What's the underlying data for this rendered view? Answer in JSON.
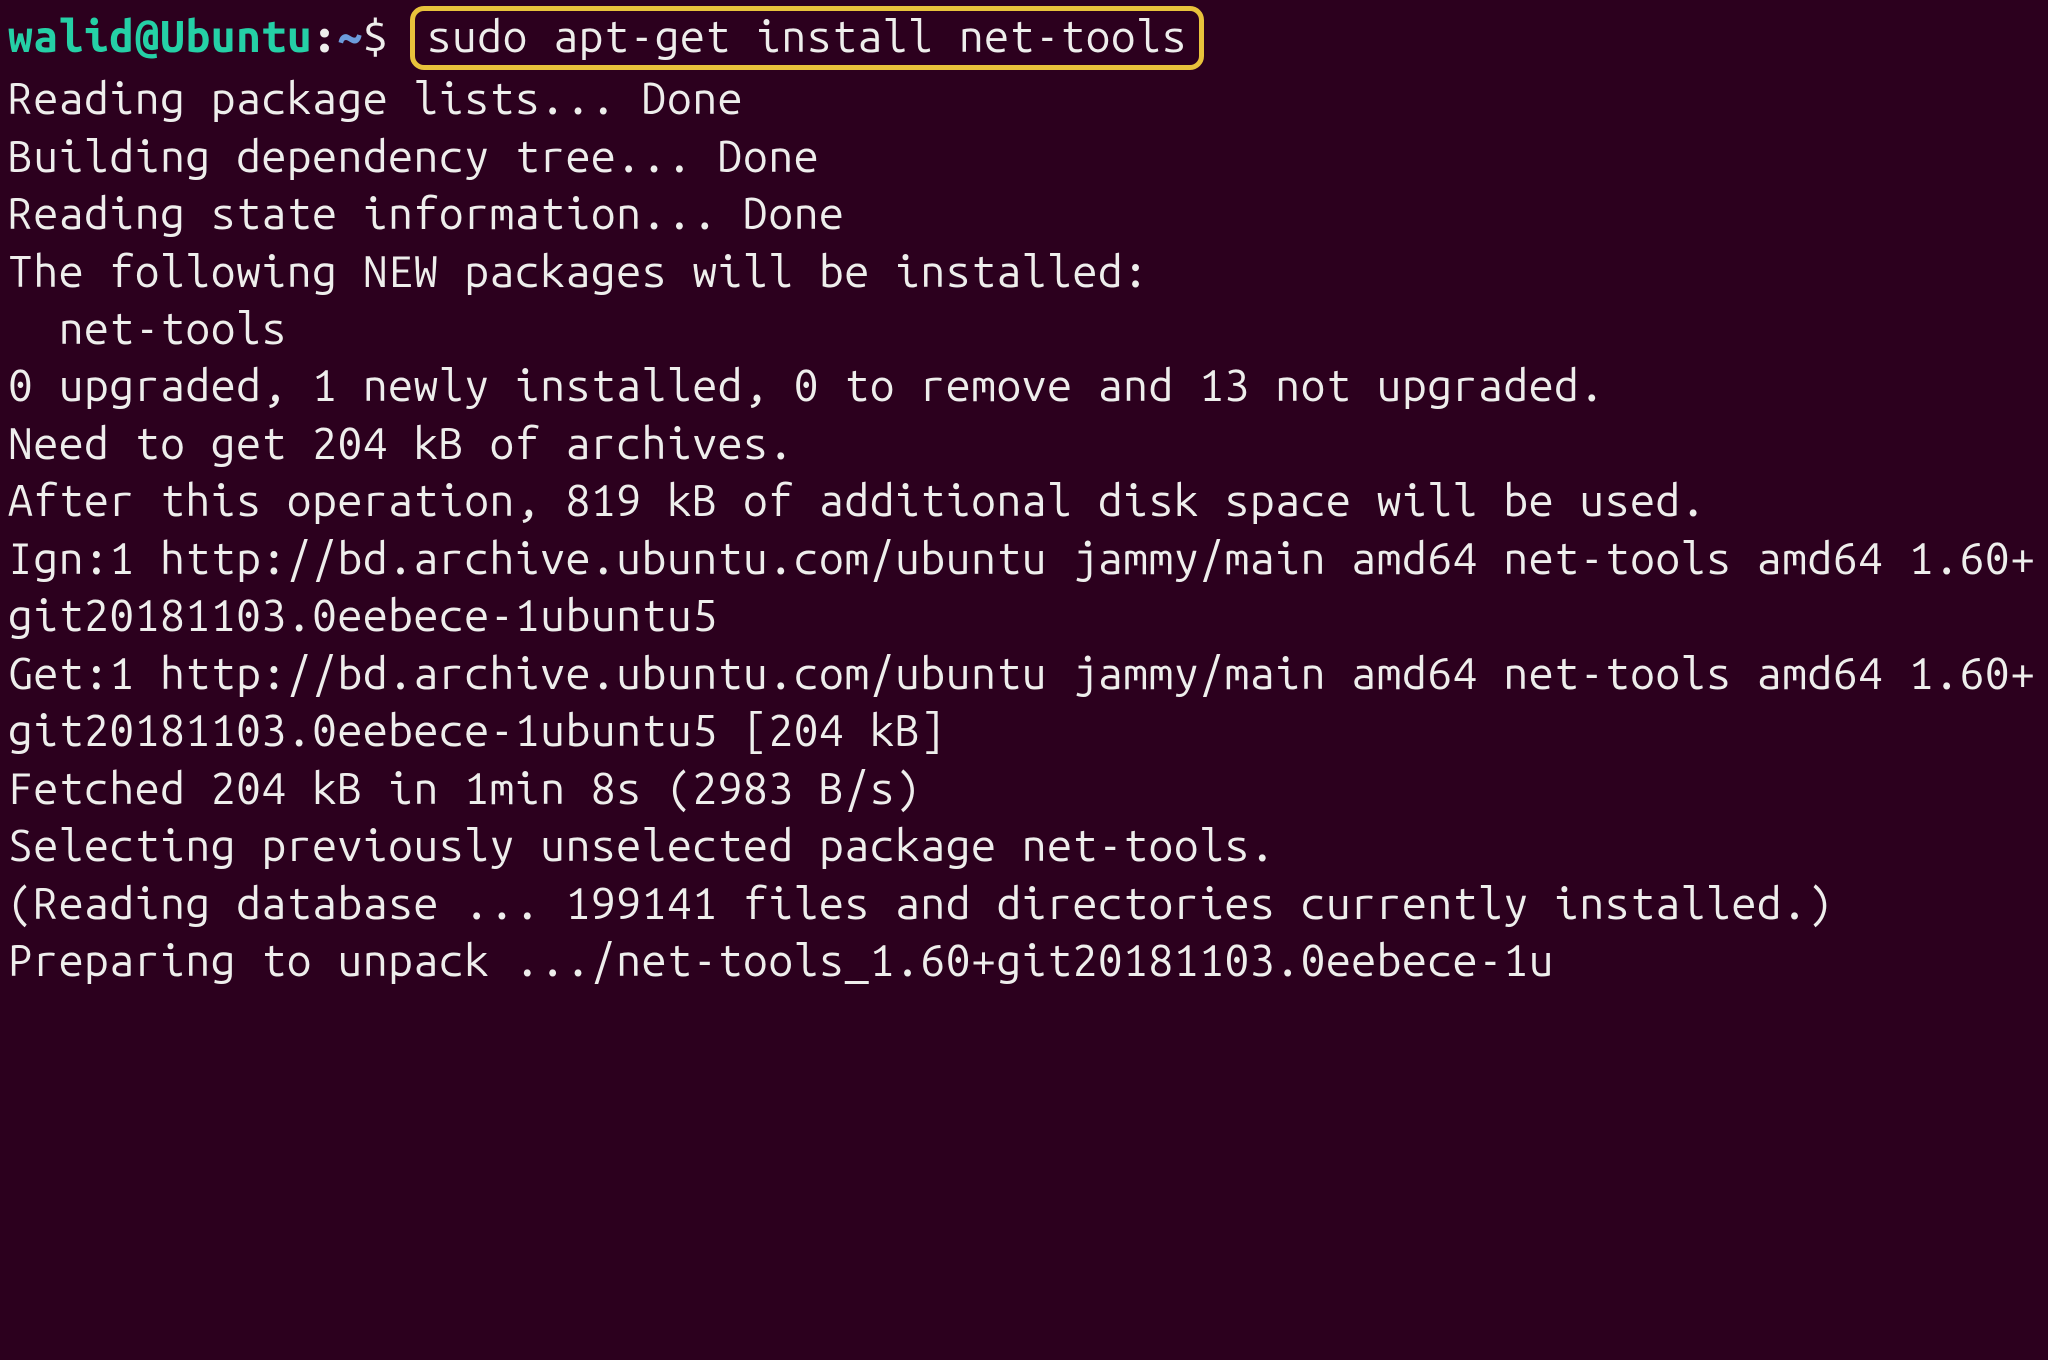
{
  "prompt": {
    "user": "walid",
    "at": "@",
    "host": "Ubuntu",
    "colon": ":",
    "path": "~",
    "dollar": "$ ",
    "command": "sudo apt-get install net-tools"
  },
  "output": "Reading package lists... Done\nBuilding dependency tree... Done\nReading state information... Done\nThe following NEW packages will be installed:\n  net-tools\n0 upgraded, 1 newly installed, 0 to remove and 13 not upgraded.\nNeed to get 204 kB of archives.\nAfter this operation, 819 kB of additional disk space will be used.\nIgn:1 http://bd.archive.ubuntu.com/ubuntu jammy/main amd64 net-tools amd64 1.60+git20181103.0eebece-1ubuntu5\nGet:1 http://bd.archive.ubuntu.com/ubuntu jammy/main amd64 net-tools amd64 1.60+git20181103.0eebece-1ubuntu5 [204 kB]\nFetched 204 kB in 1min 8s (2983 B/s)\nSelecting previously unselected package net-tools.\n(Reading database ... 199141 files and directories currently installed.)\nPreparing to unpack .../net-tools_1.60+git20181103.0eebece-1u"
}
